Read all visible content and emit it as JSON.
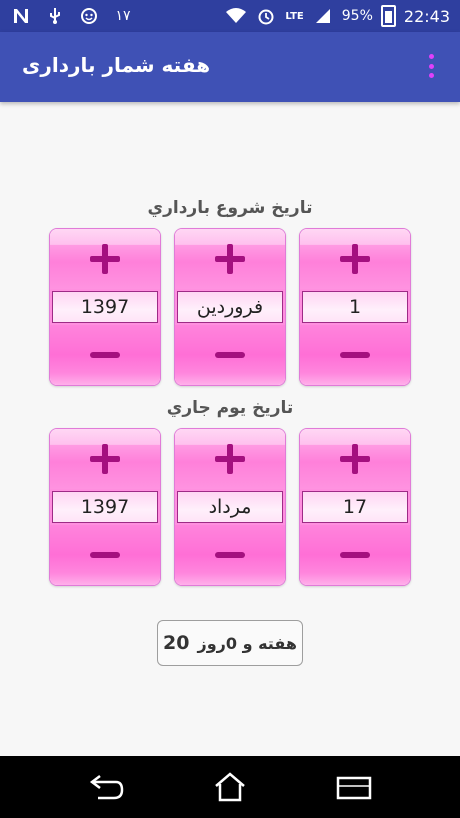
{
  "status_bar": {
    "left_icons": [
      "n-icon",
      "usb-icon",
      "face-icon",
      "persian-digit-17"
    ],
    "left_label": "۱۷",
    "battery_percent": "95%",
    "network_label": "LTE",
    "time": "22:43"
  },
  "app_bar": {
    "title": "هفته شمار بارداری"
  },
  "start_section": {
    "title": "تاريخ شروع بارداري",
    "year": "1397",
    "month": "فروردين",
    "day": "1"
  },
  "current_section": {
    "title": "تاريخ يوم جاري",
    "year": "1397",
    "month": "مرداد",
    "day": "17"
  },
  "result": {
    "weeks": "20",
    "text": "هفته و 0روز"
  },
  "nav_bar": {
    "buttons": [
      "back-icon",
      "home-icon",
      "recents-icon"
    ]
  },
  "colors": {
    "status_bar": "#2f3f9f",
    "app_bar": "#3f51b5",
    "picker_pink": "#ff80da",
    "sign_color": "#a4107f",
    "menu_dots": "#e040fb"
  }
}
